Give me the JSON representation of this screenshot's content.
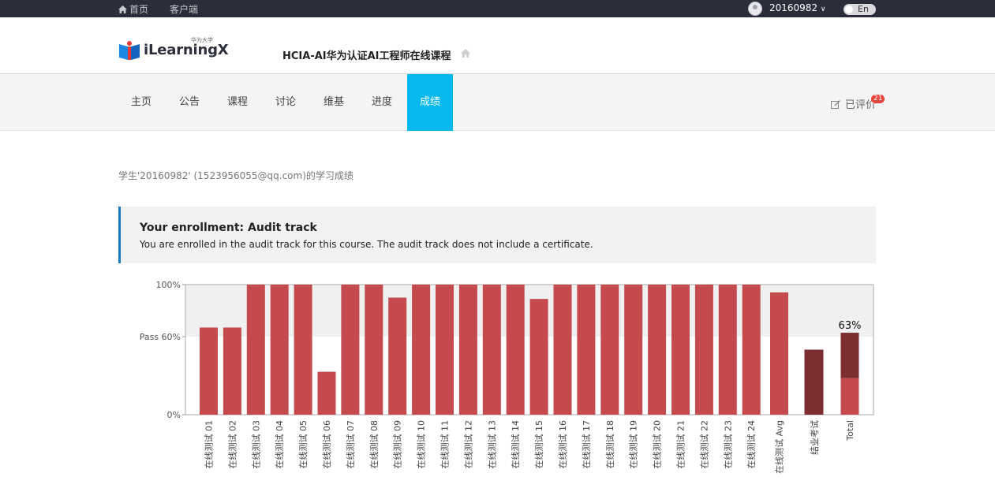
{
  "topbar": {
    "home_label": "首页",
    "client_label": "客户端",
    "username": "20160982",
    "lang_label": "En"
  },
  "header": {
    "logo_text": "iLearningX",
    "logo_sub": "华为大学",
    "course_title": "HCIA-AI华为认证AI工程师在线课程"
  },
  "nav": {
    "tabs": [
      "主页",
      "公告",
      "课程",
      "讨论",
      "维基",
      "进度",
      "成绩"
    ],
    "active_tab": "成绩",
    "rated_label": "已评价",
    "rated_count": "21"
  },
  "page": {
    "student_line": "学生'20160982' (1523956055@qq.com)的学习成绩",
    "notice_title": "Your enrollment: Audit track",
    "notice_text": "You are enrolled in the audit track for this course. The audit track does not include a certificate."
  },
  "colors": {
    "accent": "#05b8f0",
    "bar": "#c44a4e",
    "bar_dark": "#7c2e30",
    "topbar": "#2b2d3b"
  },
  "chart_data": {
    "type": "bar",
    "y_ticks": [
      {
        "value": 100,
        "label": "100%"
      },
      {
        "value": 60,
        "label": "Pass 60%"
      },
      {
        "value": 0,
        "label": "0%"
      }
    ],
    "ylim": [
      0,
      100
    ],
    "pass_threshold": 60,
    "categories": [
      "在线测试 01",
      "在线测试 02",
      "在线测试 03",
      "在线测试 04",
      "在线测试 05",
      "在线测试 06",
      "在线测试 07",
      "在线测试 08",
      "在线测试 09",
      "在线测试 10",
      "在线测试 11",
      "在线测试 12",
      "在线测试 13",
      "在线测试 14",
      "在线测试 15",
      "在线测试 16",
      "在线测试 17",
      "在线测试 18",
      "在线测试 19",
      "在线测试 20",
      "在线测试 21",
      "在线测试 22",
      "在线测试 23",
      "在线测试 24"
    ],
    "values": [
      67,
      67,
      100,
      100,
      100,
      33,
      100,
      100,
      90,
      100,
      100,
      100,
      100,
      100,
      89,
      100,
      100,
      100,
      100,
      100,
      100,
      100,
      100,
      100
    ],
    "avg_label": "在线测试 Avg",
    "avg_value": 94,
    "final_label": "结业考试",
    "final_value": 50,
    "total_label": "Total",
    "total_value": 63,
    "total_text": "63%",
    "total_base_value": 28
  }
}
